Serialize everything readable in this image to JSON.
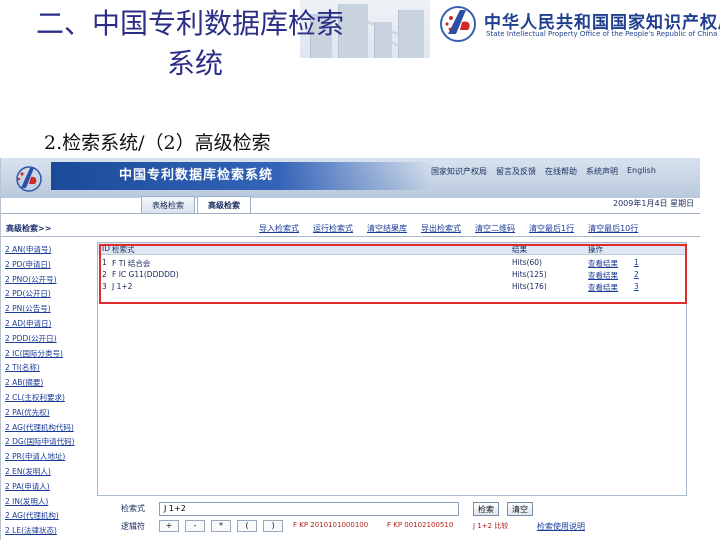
{
  "slide": {
    "title_line1": "二、中国专利数据库检索",
    "title_line2": "系统",
    "subtitle": "2.检索系统/（2）高级检索"
  },
  "logo": {
    "name_cn": "中华人民共和国国家知识产权局",
    "name_en": "State Intellectual Property Office of the People's Republic of China"
  },
  "app": {
    "banner_title": "中国专利数据库检索系统",
    "top_links": [
      "国家知识产权局",
      "留言及反馈",
      "在线帮助",
      "系统声明",
      "English"
    ],
    "tabs": [
      "表格检索",
      "高级检索"
    ],
    "active_tab": 1,
    "date": "2009年1月4日 星期日"
  },
  "toolbar": {
    "title": "高级检索>>",
    "links": [
      "导入检索式",
      "运行检索式",
      "清空结果库",
      "导出检索式",
      "清空二维码",
      "清空最后1行",
      "清空最后10行"
    ]
  },
  "fields": [
    "2 AN(申请号)",
    "2 PD(申请日)",
    "2 PNO(公开号)",
    "2 PD(公开日)",
    "2 PN(公告号)",
    "2 AD(申请日)",
    "2 PDD(公开日)",
    "2 IC(国际分类号)",
    "2 TI(名称)",
    "2 AB(摘要)",
    "2 CL(主权利要求)",
    "2 PA(优先权)",
    "2 AG(代理机构代码)",
    "2 DG(国际申请代码)",
    "2 PR(申请人地址)",
    "2 EN(发明人)",
    "2 PA(申请人)",
    "2 IN(发明人)",
    "2 AG(代理机构)",
    "2 LE(法律状态)"
  ],
  "results": {
    "headers": [
      "ID",
      "检索式",
      "结果",
      "操作"
    ],
    "rows": [
      {
        "id": "1",
        "query": "F TI 结合会",
        "hits": "Hits(60)",
        "action": "查看结果",
        "action2": "1"
      },
      {
        "id": "2",
        "query": "F IC G11(DDDDD)",
        "hits": "Hits(125)",
        "action": "查看结果",
        "action2": "2"
      },
      {
        "id": "3",
        "query": "J 1+2",
        "hits": "Hits(176)",
        "action": "查看结果",
        "action2": "3"
      }
    ]
  },
  "form": {
    "query_label": "检索式",
    "query_value": "J 1+2",
    "search_button": "检索",
    "clear_button": "清空",
    "ops_label": "逻辑符",
    "operators": [
      "+",
      "-",
      "*",
      "(",
      ")"
    ],
    "example1": "F KP 2010101000100",
    "example2": "F KP 00102100510",
    "example3": "J 1+2 比较",
    "help_link": "检索使用说明"
  },
  "colors": {
    "title": "#2b2e86",
    "highlight_box": "#e02b2b",
    "banner": "#1c4a9a",
    "link": "#1b3c99"
  }
}
